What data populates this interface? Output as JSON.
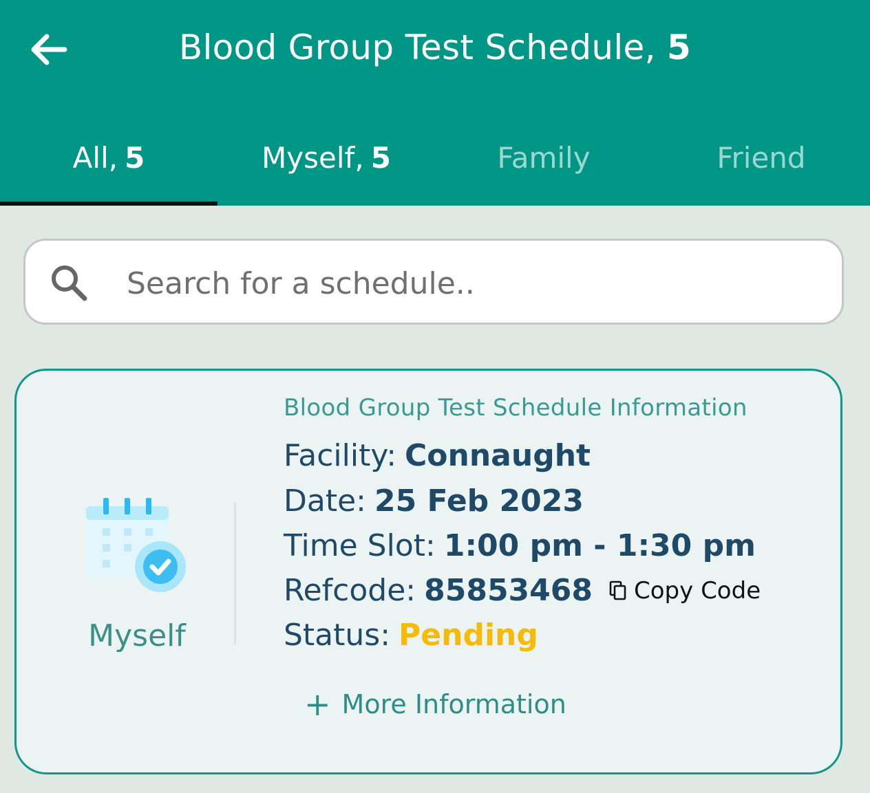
{
  "header": {
    "title": "Blood Group Test Schedule,",
    "count": "5",
    "back_icon": "arrow-left-icon"
  },
  "tabs": [
    {
      "label": "All,",
      "count": "5",
      "active": true
    },
    {
      "label": "Myself,",
      "count": "5",
      "active": false
    },
    {
      "label": "Family",
      "count": "",
      "active": false
    },
    {
      "label": "Friend",
      "count": "",
      "active": false
    }
  ],
  "search": {
    "placeholder": "Search for a schedule..",
    "value": "",
    "icon": "search-icon"
  },
  "card": {
    "icon": "calendar-check-icon",
    "who": "Myself",
    "info_title": "Blood Group Test Schedule Information",
    "facility_label": "Facility:",
    "facility_value": "Connaught",
    "date_label": "Date:",
    "date_value": "25 Feb 2023",
    "time_label": "Time Slot:",
    "time_value": "1:00 pm - 1:30 pm",
    "refcode_label": "Refcode:",
    "refcode_value": "85853468",
    "copy_label": "Copy Code",
    "status_label": "Status:",
    "status_value": "Pending",
    "more_label": "More Information"
  },
  "colors": {
    "primary": "#009685",
    "background": "#e0e8e4",
    "card_bg": "#ebf3f3",
    "card_border": "#0f958a",
    "text_dark": "#1f4966",
    "status_pending": "#f5bb08"
  }
}
